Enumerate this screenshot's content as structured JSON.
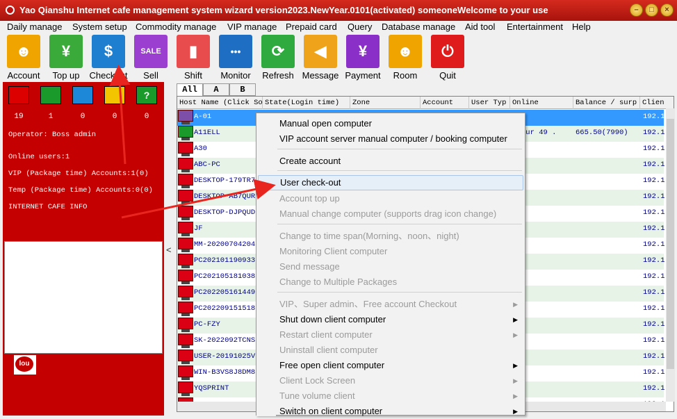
{
  "window": {
    "title": "Yao Qianshu Internet cafe management system wizard version2023.NewYear.0101(activated)  someoneWelcome to your use",
    "controls": [
      "minimize",
      "maximize",
      "close"
    ]
  },
  "menu": [
    "Daily manage",
    "System setup",
    "Commodity manage",
    "VIP manage",
    "Prepaid card",
    "Query",
    "Database manage",
    "Aid tool",
    "Entertainment",
    "Help"
  ],
  "toolbar": [
    {
      "label": "Account",
      "icon": "user-icon",
      "color": "#f0a400"
    },
    {
      "label": "Top up",
      "icon": "money-bag-icon",
      "color": "#3aab3a"
    },
    {
      "label": "Checkout",
      "icon": "checkout-icon",
      "color": "#1e7fd0"
    },
    {
      "label": "Sell",
      "icon": "sale-tag-icon",
      "color": "#9b3fd1"
    },
    {
      "label": "Shift",
      "icon": "shift-icon",
      "color": "#e84c4c"
    },
    {
      "label": "Monitor",
      "icon": "monitor-chat-icon",
      "color": "#1e6fc4"
    },
    {
      "label": "Refresh",
      "icon": "refresh-icon",
      "color": "#2faa3f"
    },
    {
      "label": "Message",
      "icon": "megaphone-icon",
      "color": "#eea31a"
    },
    {
      "label": "Payment",
      "icon": "yen-icon",
      "color": "#8a2fc8"
    },
    {
      "label": "Room",
      "icon": "user-icon",
      "color": "#f0a400"
    },
    {
      "label": "Quit",
      "icon": "power-icon",
      "color": "#e01b1b"
    }
  ],
  "status_counts": [
    {
      "value": "19",
      "color": "#dd0000"
    },
    {
      "value": "1",
      "color": "#1a9a2a"
    },
    {
      "value": "0",
      "color": "#1e88d8"
    },
    {
      "value": "0",
      "color": "#f3c400"
    },
    {
      "value": "0",
      "color": "#1a9a2a"
    }
  ],
  "info": {
    "operator": "Operator: Boss admin",
    "online_users": "Online users:1",
    "vip": "VIP (Package time) Accounts:1(0)",
    "temp": "Temp (Package time) Accounts:0(0)",
    "cafe_info": "INTERNET CAFE  INFO"
  },
  "tabs": [
    "All",
    "A",
    "B"
  ],
  "columns": [
    "Host Name (Click So",
    "State(Login time)",
    "Zone",
    "Account",
    "User Typ",
    "Online",
    "Balance / surp",
    "Clien"
  ],
  "rows": [
    {
      "host": "A-01",
      "status": "purple",
      "online": "",
      "balance": "",
      "client": "192.1"
    },
    {
      "host": "A11ELL",
      "status": "green",
      "online": "our 49 .",
      "balance": "665.50(7990)",
      "client": "192.1"
    },
    {
      "host": "A30",
      "status": "red",
      "online": "",
      "balance": "",
      "client": "192.1"
    },
    {
      "host": "ABC-PC",
      "status": "red",
      "online": "",
      "balance": "",
      "client": "192.1"
    },
    {
      "host": "DESKTOP-179TR72",
      "status": "red",
      "online": "",
      "balance": "",
      "client": "192.1"
    },
    {
      "host": "DESKTOP-AB7QURE",
      "status": "red",
      "online": "",
      "balance": "",
      "client": "192.1"
    },
    {
      "host": "DESKTOP-DJPQUD5",
      "status": "red",
      "online": "",
      "balance": "",
      "client": "192.1"
    },
    {
      "host": "JF",
      "status": "red",
      "online": "",
      "balance": "",
      "client": "192.1"
    },
    {
      "host": "MM-202007042048",
      "status": "red",
      "online": "",
      "balance": "",
      "client": "192.1"
    },
    {
      "host": "PC202101190933",
      "status": "red",
      "online": "",
      "balance": "",
      "client": "192.1"
    },
    {
      "host": "PC202105181038",
      "status": "red",
      "online": "",
      "balance": "",
      "client": "192.1"
    },
    {
      "host": "PC202205161449",
      "status": "red",
      "online": "",
      "balance": "",
      "client": "192.1"
    },
    {
      "host": "PC202209151518",
      "status": "red",
      "online": "",
      "balance": "",
      "client": "192.1"
    },
    {
      "host": "PC-FZY",
      "status": "red",
      "online": "",
      "balance": "",
      "client": "192.1"
    },
    {
      "host": "SK-2022092TCNSJ",
      "status": "red",
      "online": "",
      "balance": "",
      "client": "192.1"
    },
    {
      "host": "USER-20191025VU",
      "status": "red",
      "online": "",
      "balance": "",
      "client": "192.1"
    },
    {
      "host": "WIN-B3VS8J8DM83",
      "status": "red",
      "online": "",
      "balance": "",
      "client": "192.1"
    },
    {
      "host": "YQSPRINT",
      "status": "red",
      "online": "",
      "balance": "",
      "client": "192.1"
    },
    {
      "host": "",
      "status": "red",
      "online": "",
      "balance": "",
      "client": "192.1"
    }
  ],
  "context_menu": [
    {
      "label": "Manual open computer",
      "disabled": false,
      "submenu": false
    },
    {
      "label": "VIP account server manual computer / booking computer",
      "disabled": false,
      "submenu": false
    },
    {
      "label": "Create account",
      "disabled": false,
      "submenu": false
    },
    {
      "label": "User check-out",
      "disabled": false,
      "submenu": false,
      "highlighted": true
    },
    {
      "label": "Account top up",
      "disabled": true,
      "submenu": false
    },
    {
      "label": "Manual change computer (supports drag icon change)",
      "disabled": true,
      "submenu": false
    },
    {
      "label": "Change to time span(Morning、noon、night)",
      "disabled": true,
      "submenu": false
    },
    {
      "label": "Monitoring Client computer",
      "disabled": true,
      "submenu": false
    },
    {
      "label": "Send message",
      "disabled": true,
      "submenu": false
    },
    {
      "label": "Change to Multiple Packages",
      "disabled": true,
      "submenu": false
    },
    {
      "label": "VIP、Super admin、Free account Checkout",
      "disabled": true,
      "submenu": true
    },
    {
      "label": "Shut down client computer",
      "disabled": false,
      "submenu": true
    },
    {
      "label": "Restart client computer",
      "disabled": true,
      "submenu": true
    },
    {
      "label": "Uninstall client computer",
      "disabled": true,
      "submenu": false
    },
    {
      "label": "Free open client computer",
      "disabled": false,
      "submenu": true
    },
    {
      "label": "Client Lock Screen",
      "disabled": true,
      "submenu": true
    },
    {
      "label": "Tune  volume client",
      "disabled": true,
      "submenu": true
    },
    {
      "label": "Switch on client computer",
      "disabled": false,
      "submenu": true
    }
  ],
  "logo_text": "lou",
  "glyphs": {
    "user": "☻",
    "money": "¥",
    "checkout": "$",
    "sale": "SALE",
    "shift": "▮",
    "monitor": "•••",
    "refresh": "⟳",
    "megaphone": "◀",
    "yen": "¥",
    "power": "⏻",
    "submenu_arrow": "▶",
    "collapse": "<",
    "minimize": "–",
    "maximize": "□",
    "close": "×",
    "question": "?"
  }
}
